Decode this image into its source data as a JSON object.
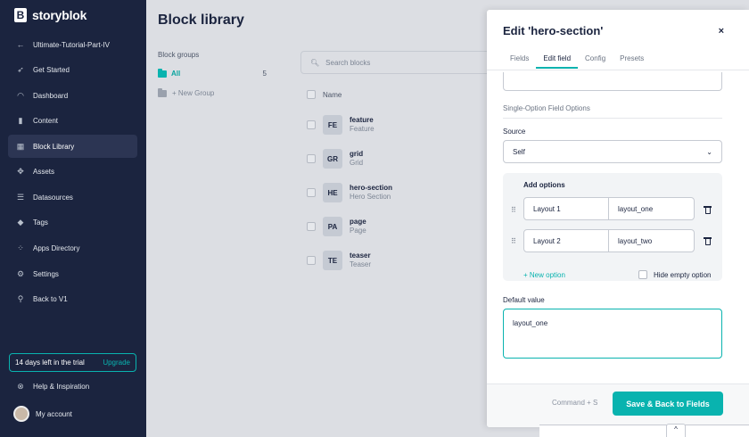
{
  "app": {
    "brand": "storyblok",
    "accent": "#09b3af",
    "sidebar_bg": "#1b243f"
  },
  "sidebar": {
    "back_label": "Ultimate-Tutorial-Part-IV",
    "items": [
      {
        "label": "Get Started",
        "icon": "rocket-icon"
      },
      {
        "label": "Dashboard",
        "icon": "gauge-icon"
      },
      {
        "label": "Content",
        "icon": "content-icon"
      },
      {
        "label": "Block Library",
        "icon": "blocks-icon",
        "active": true
      },
      {
        "label": "Assets",
        "icon": "assets-icon"
      },
      {
        "label": "Datasources",
        "icon": "datasources-icon"
      },
      {
        "label": "Tags",
        "icon": "tag-icon"
      },
      {
        "label": "Apps Directory",
        "icon": "apps-icon"
      },
      {
        "label": "Settings",
        "icon": "gear-icon"
      },
      {
        "label": "Back to V1",
        "icon": "v1-icon"
      }
    ],
    "trial": {
      "text": "14 days left in the trial",
      "upgrade": "Upgrade"
    },
    "help": "Help & Inspiration",
    "account": "My account"
  },
  "main": {
    "title": "Block library",
    "groups_title": "Block groups",
    "group_all": {
      "label": "All",
      "count": "5"
    },
    "new_group": "+ New Group",
    "search_placeholder": "Search blocks",
    "column_name": "Name",
    "blocks": [
      {
        "badge": "FE",
        "name": "feature",
        "display": "Feature"
      },
      {
        "badge": "GR",
        "name": "grid",
        "display": "Grid"
      },
      {
        "badge": "HE",
        "name": "hero-section",
        "display": "Hero Section"
      },
      {
        "badge": "PA",
        "name": "page",
        "display": "Page"
      },
      {
        "badge": "TE",
        "name": "teaser",
        "display": "Teaser"
      }
    ]
  },
  "drawer": {
    "title": "Edit 'hero-section'",
    "close": "×",
    "tabs": [
      {
        "label": "Fields"
      },
      {
        "label": "Edit field",
        "active": true
      },
      {
        "label": "Config"
      },
      {
        "label": "Presets"
      }
    ],
    "section_title": "Single-Option Field Options",
    "source_label": "Source",
    "source_value": "Self",
    "add_options_title": "Add options",
    "options": [
      {
        "name": "Layout 1",
        "value": "layout_one"
      },
      {
        "name": "Layout 2",
        "value": "layout_two"
      }
    ],
    "new_option": "+ New option",
    "hide_empty": "Hide empty option",
    "default_label": "Default value",
    "default_value": "layout_one",
    "shortcut": "Command + S",
    "primary_button": "Save & Back to Fields",
    "scroll_up": "^"
  }
}
